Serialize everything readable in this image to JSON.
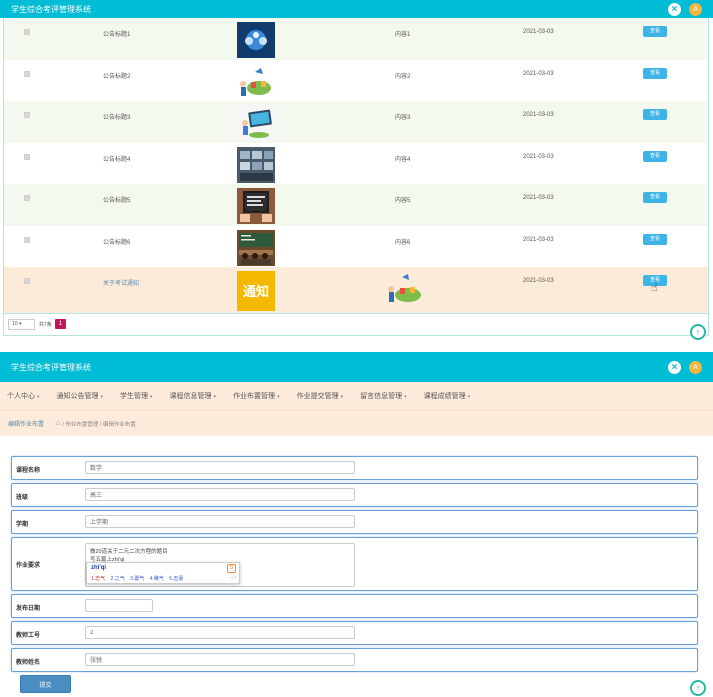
{
  "app": {
    "title": "学生综合考评管理系统",
    "avatar_letter": "A"
  },
  "list": {
    "rows": [
      {
        "title": "公告标题1",
        "content": "内容1",
        "date": "2021-03-03",
        "action": "查看"
      },
      {
        "title": "公告标题2",
        "content": "内容2",
        "date": "2021-03-03",
        "action": "查看"
      },
      {
        "title": "公告标题3",
        "content": "内容3",
        "date": "2021-03-03",
        "action": "查看"
      },
      {
        "title": "公告标题4",
        "content": "内容4",
        "date": "2021-03-03",
        "action": "查看"
      },
      {
        "title": "公告标题5",
        "content": "内容5",
        "date": "2021-03-03",
        "action": "查看"
      },
      {
        "title": "公告标题6",
        "content": "内容6",
        "date": "2021-03-03",
        "action": "查看"
      },
      {
        "title": "关于考试通知",
        "content": "",
        "date": "2021-03-03",
        "action": "查看",
        "image_text": "通知"
      }
    ],
    "pager": {
      "page_size": "10",
      "total": "共7条",
      "current_page": "1"
    }
  },
  "menu": {
    "items": [
      {
        "label": "个人中心"
      },
      {
        "label": "通知公告管理"
      },
      {
        "label": "学生管理"
      },
      {
        "label": "课程信息管理"
      },
      {
        "label": "作业布置管理"
      },
      {
        "label": "作业提交管理"
      },
      {
        "label": "留言信息管理"
      },
      {
        "label": "课程成绩管理"
      }
    ]
  },
  "breadcrumb": {
    "current": "编辑作业布置",
    "path": "/ 作业布置管理 / 编辑作业布置"
  },
  "form": {
    "course": {
      "label": "课程名称",
      "value": "数学"
    },
    "class": {
      "label": "班级",
      "value": "高三"
    },
    "term": {
      "label": "学期",
      "value": "上学期"
    },
    "requirement": {
      "label": "作业要求",
      "line1": "做20道关于二元二次方程的题目",
      "line2": "写五篇上zhi'qi"
    },
    "ime": {
      "pinyin": "zhi'qi",
      "candidates": [
        "1.志气",
        "2.之气",
        "3.置气",
        "4.稚气",
        "5.志豪"
      ],
      "nav": "‹ ›"
    },
    "publish_date": {
      "label": "发布日期",
      "value": ""
    },
    "teacher_id": {
      "label": "教师工号",
      "value": "2"
    },
    "teacher_name": {
      "label": "教师姓名",
      "value": "张锐"
    },
    "submit_label": "提交"
  },
  "colors": {
    "header": "#00bcd4",
    "button": "#3db3e6",
    "pager_active": "#c2185b",
    "menu_bg": "#fdebdb"
  }
}
